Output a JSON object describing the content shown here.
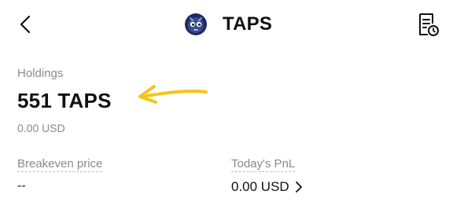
{
  "header": {
    "title": "TAPS",
    "back_icon": "chevron-left-icon",
    "history_icon": "document-clock-icon",
    "token_icon": "taps-logo-icon"
  },
  "holdings": {
    "label": "Holdings",
    "amount": "551 TAPS",
    "usd_value": "0.00 USD"
  },
  "annotation": {
    "icon": "yellow-hand-drawn-arrow",
    "color": "#F5C518"
  },
  "stats": {
    "breakeven_label": "Breakeven price",
    "breakeven_value": "--",
    "pnl_label": "Today's PnL",
    "pnl_value": "0.00 USD"
  }
}
